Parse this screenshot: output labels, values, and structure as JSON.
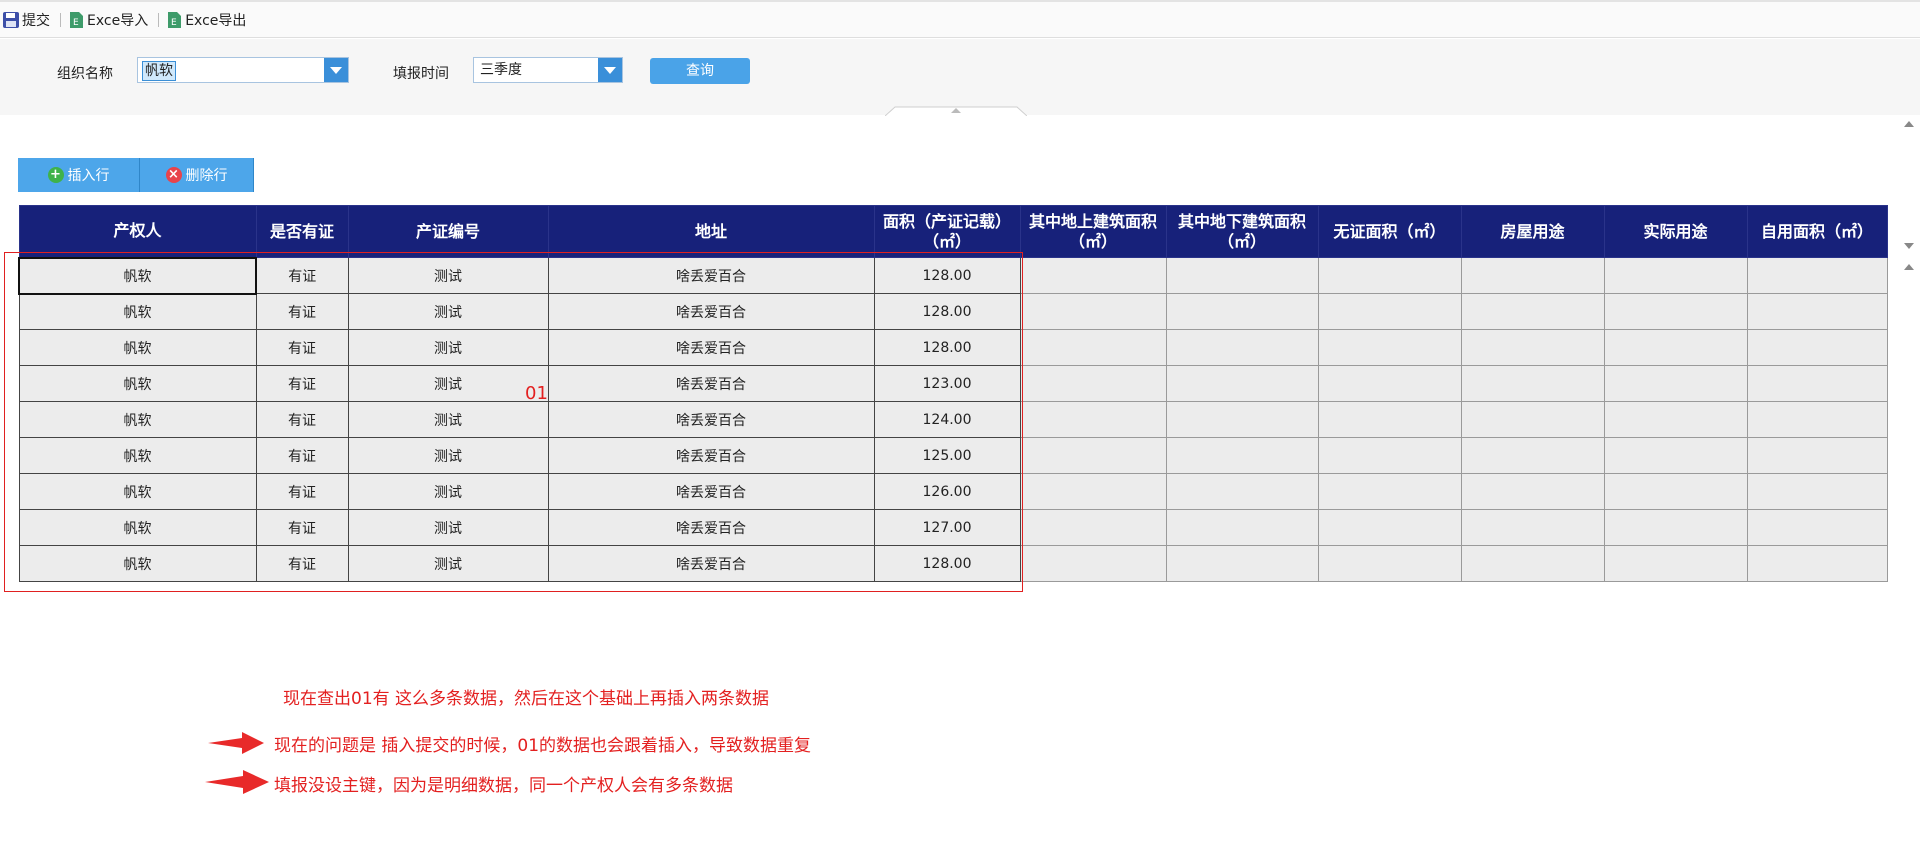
{
  "toolbar": {
    "submit": "提交",
    "excel_import": "Exce导入",
    "excel_export": "Exce导出"
  },
  "filter": {
    "org_label": "组织名称",
    "org_value": "帆软",
    "period_label": "填报时间",
    "period_value": "三季度",
    "query_button": "查询"
  },
  "grid_actions": {
    "insert_row": "插入行",
    "delete_row": "删除行"
  },
  "table": {
    "headers": [
      "产权人",
      "是否有证",
      "产证编号",
      "地址",
      "面积（产证记载）（㎡）",
      "其中地上建筑面积（㎡）",
      "其中地下建筑面积（㎡）",
      "无证面积（㎡）",
      "房屋用途",
      "实际用途",
      "自用面积（㎡）"
    ],
    "rows": [
      [
        "帆软",
        "有证",
        "测试",
        "啥丢爱百合",
        "128.00",
        "",
        "",
        "",
        "",
        "",
        ""
      ],
      [
        "帆软",
        "有证",
        "测试",
        "啥丢爱百合",
        "128.00",
        "",
        "",
        "",
        "",
        "",
        ""
      ],
      [
        "帆软",
        "有证",
        "测试",
        "啥丢爱百合",
        "128.00",
        "",
        "",
        "",
        "",
        "",
        ""
      ],
      [
        "帆软",
        "有证",
        "测试",
        "啥丢爱百合",
        "123.00",
        "",
        "",
        "",
        "",
        "",
        ""
      ],
      [
        "帆软",
        "有证",
        "测试",
        "啥丢爱百合",
        "124.00",
        "",
        "",
        "",
        "",
        "",
        ""
      ],
      [
        "帆软",
        "有证",
        "测试",
        "啥丢爱百合",
        "125.00",
        "",
        "",
        "",
        "",
        "",
        ""
      ],
      [
        "帆软",
        "有证",
        "测试",
        "啥丢爱百合",
        "126.00",
        "",
        "",
        "",
        "",
        "",
        ""
      ],
      [
        "帆软",
        "有证",
        "测试",
        "啥丢爱百合",
        "127.00",
        "",
        "",
        "",
        "",
        "",
        ""
      ],
      [
        "帆软",
        "有证",
        "测试",
        "啥丢爱百合",
        "128.00",
        "",
        "",
        "",
        "",
        "",
        ""
      ]
    ]
  },
  "annotations": {
    "marker": "01",
    "note1": "现在查出01有 这么多条数据，然后在这个基础上再插入两条数据",
    "note2": "现在的问题是 插入提交的时候，01的数据也会跟着插入，导致数据重复",
    "note3": "填报没设主键，因为是明细数据，同一个产权人会有多条数据"
  },
  "colors": {
    "header_bg": "#17217a",
    "button_blue": "#4da6ea",
    "annotation_red": "#e32020"
  }
}
